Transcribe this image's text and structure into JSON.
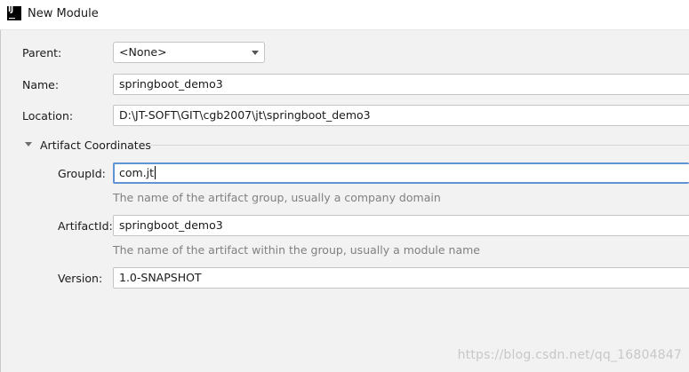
{
  "window": {
    "title": "New Module",
    "icon": "intellij-idea-icon",
    "icon_text": "IJ"
  },
  "form": {
    "parent": {
      "label": "Parent:",
      "value": "<None>"
    },
    "name": {
      "label": "Name:",
      "value": "springboot_demo3"
    },
    "location": {
      "label": "Location:",
      "value": "D:\\JT-SOFT\\GIT\\cgb2007\\jt\\springboot_demo3"
    }
  },
  "artifact": {
    "section_title": "Artifact Coordinates",
    "group_id": {
      "label": "GroupId:",
      "value": "com.jt",
      "hint": "The name of the artifact group, usually a company domain"
    },
    "artifact_id": {
      "label": "ArtifactId:",
      "value": "springboot_demo3",
      "hint": "The name of the artifact within the group, usually a module name"
    },
    "version": {
      "label": "Version:",
      "value": "1.0-SNAPSHOT"
    }
  },
  "watermark": "https://blog.csdn.net/qq_16804847",
  "colors": {
    "focus_border": "#5f93d3",
    "hint_text": "#808080",
    "background": "#f2f2f2"
  }
}
